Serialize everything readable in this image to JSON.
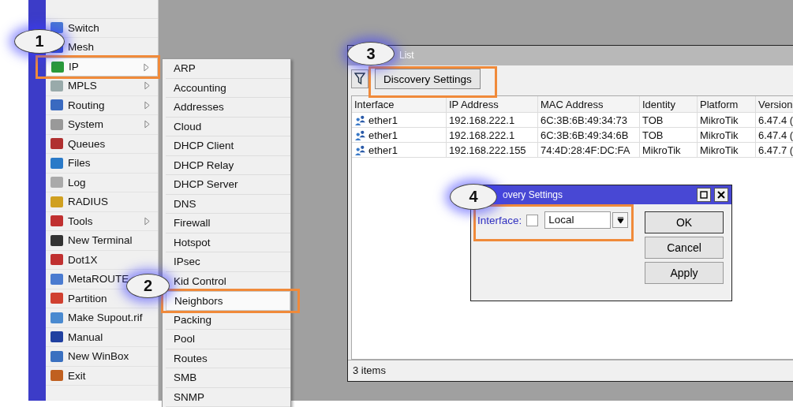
{
  "main_menu": [
    {
      "label": "Switch",
      "has_submenu": false,
      "selected": false
    },
    {
      "label": "Mesh",
      "has_submenu": false,
      "selected": false
    },
    {
      "label": "IP",
      "has_submenu": true,
      "selected": true
    },
    {
      "label": "MPLS",
      "has_submenu": true,
      "selected": false
    },
    {
      "label": "Routing",
      "has_submenu": true,
      "selected": false
    },
    {
      "label": "System",
      "has_submenu": true,
      "selected": false
    },
    {
      "label": "Queues",
      "has_submenu": false,
      "selected": false
    },
    {
      "label": "Files",
      "has_submenu": false,
      "selected": false
    },
    {
      "label": "Log",
      "has_submenu": false,
      "selected": false
    },
    {
      "label": "RADIUS",
      "has_submenu": false,
      "selected": false
    },
    {
      "label": "Tools",
      "has_submenu": true,
      "selected": false
    },
    {
      "label": "New Terminal",
      "has_submenu": false,
      "selected": false
    },
    {
      "label": "Dot1X",
      "has_submenu": false,
      "selected": false
    },
    {
      "label": "MetaROUTE",
      "has_submenu": false,
      "selected": false
    },
    {
      "label": "Partition",
      "has_submenu": false,
      "selected": false
    },
    {
      "label": "Make Supout.rif",
      "has_submenu": false,
      "selected": false
    },
    {
      "label": "Manual",
      "has_submenu": false,
      "selected": false
    },
    {
      "label": "New WinBox",
      "has_submenu": false,
      "selected": false
    },
    {
      "label": "Exit",
      "has_submenu": false,
      "selected": false
    }
  ],
  "ip_submenu": [
    {
      "label": "ARP",
      "selected": false
    },
    {
      "label": "Accounting",
      "selected": false
    },
    {
      "label": "Addresses",
      "selected": false
    },
    {
      "label": "Cloud",
      "selected": false
    },
    {
      "label": "DHCP Client",
      "selected": false
    },
    {
      "label": "DHCP Relay",
      "selected": false
    },
    {
      "label": "DHCP Server",
      "selected": false
    },
    {
      "label": "DNS",
      "selected": false
    },
    {
      "label": "Firewall",
      "selected": false
    },
    {
      "label": "Hotspot",
      "selected": false
    },
    {
      "label": "IPsec",
      "selected": false
    },
    {
      "label": "Kid Control",
      "selected": false
    },
    {
      "label": "Neighbors",
      "selected": true
    },
    {
      "label": "Packing",
      "selected": false
    },
    {
      "label": "Pool",
      "selected": false
    },
    {
      "label": "Routes",
      "selected": false
    },
    {
      "label": "SMB",
      "selected": false
    },
    {
      "label": "SNMP",
      "selected": false
    }
  ],
  "neighbor_window": {
    "title": "List",
    "toolbar_button": "Discovery Settings",
    "table": {
      "columns": [
        "Interface",
        "IP Address",
        "MAC Address",
        "Identity",
        "Platform",
        "Version"
      ],
      "rows": [
        [
          "ether1",
          "192.168.222.1",
          "6C:3B:6B:49:34:73",
          "TOB",
          "MikroTik",
          "6.47.4 ("
        ],
        [
          "ether1",
          "192.168.222.1",
          "6C:3B:6B:49:34:6B",
          "TOB",
          "MikroTik",
          "6.47.4 ("
        ],
        [
          "ether1",
          "192.168.222.155",
          "74:4D:28:4F:DC:FA",
          "MikroTik",
          "MikroTik",
          "6.47.7 ("
        ]
      ]
    },
    "status_bar": "3 items"
  },
  "dialog": {
    "title": "overy Settings",
    "field_label": "Interface:",
    "checked": false,
    "value": "Local",
    "buttons": [
      "OK",
      "Cancel",
      "Apply"
    ]
  },
  "callouts": [
    "1",
    "2",
    "3",
    "4"
  ]
}
